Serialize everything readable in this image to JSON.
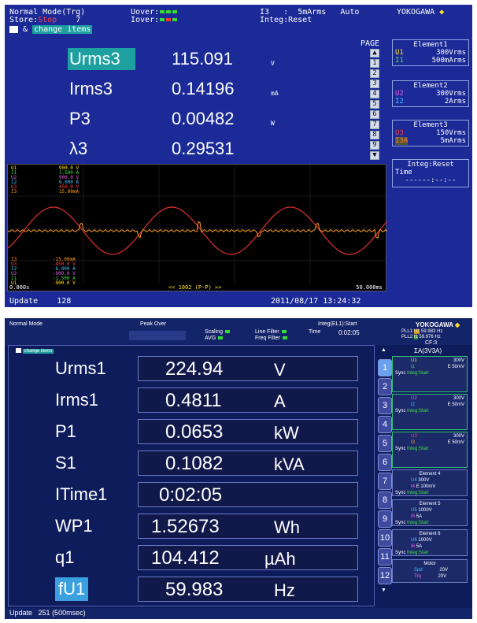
{
  "top": {
    "mode": "Normal Mode(Trg)",
    "store_label": "Store:",
    "store_value": "Stop",
    "store_count": "7",
    "uover": "Uover:",
    "iover": "Iover:",
    "range_ch": "I3",
    "range_sep": ":",
    "range_val": "5mArms",
    "range_auto": "Auto",
    "integ": "Integ:Reset",
    "brand": "YOKOGAWA",
    "change_items": "change items",
    "page_label": "PAGE",
    "pages": [
      "1",
      "2",
      "3",
      "4",
      "5",
      "6",
      "7",
      "8",
      "9"
    ],
    "rows": [
      {
        "label": "Urms3",
        "value": "115.091",
        "unit": "V"
      },
      {
        "label": "Irms3",
        "value": "0.14196",
        "unit": "mA"
      },
      {
        "label": "P3",
        "value": "0.00482",
        "unit": "W"
      },
      {
        "label": "λ3",
        "value": "0.29531",
        "unit": ""
      }
    ],
    "elements": [
      {
        "title": "Element1",
        "l1a": "U1",
        "l1b": "300Vrms",
        "l2a": "I1",
        "l2b": "500mArms"
      },
      {
        "title": "Element2",
        "l1a": "U2",
        "l1b": "300Vrms",
        "l2a": "I2",
        "l2b": "2Arms"
      },
      {
        "title": "Element3",
        "l1a": "U3",
        "l1b": "150Vrms",
        "l2a": "I3A",
        "l2b": "5mArms"
      }
    ],
    "integ_box": {
      "title": "Integ:Reset",
      "time_label": "Time",
      "time_value": "------:--:--"
    },
    "scope": {
      "upper": [
        [
          "U1",
          "900.0 V"
        ],
        [
          "I1",
          "1.500 A"
        ],
        [
          "U2",
          "900.0 V"
        ],
        [
          "I2",
          "6.000 A"
        ],
        [
          "U3",
          "450.0 V"
        ],
        [
          "I3",
          "15.00mA"
        ]
      ],
      "lower": [
        [
          "I3",
          "-15.00mA"
        ],
        [
          "U3",
          "-450.0 V"
        ],
        [
          "I2",
          "-6.000 A"
        ],
        [
          "U2",
          "-900.0 V"
        ],
        [
          "I1",
          "-1.500 A"
        ],
        [
          "U1",
          "-900.0 V"
        ]
      ],
      "t_start": "0.000s",
      "t_end": "50.000ms",
      "center": "<< 1002 (P-P) >>"
    },
    "update_label": "Update",
    "update_value": "128",
    "datetime": "2011/08/17 13:24:32"
  },
  "bottom": {
    "mode": "Normal Mode",
    "peak": "Peak Over",
    "scaling": "Scaling",
    "avg": "AVG",
    "line_filter": "Line Filter",
    "freq_filter": "Freq Filter",
    "integ": "Integ(EL1):Start",
    "time": "Time",
    "time_value": "0:02:05",
    "brand": "YOKOGAWA",
    "pll1": "PLL1:",
    "pll1_ch": "U1",
    "pll1_val": "59.983 Hz",
    "pll2": "PLL2:",
    "pll2_ch": "I1",
    "pll2_val": "59.976 Hz",
    "cf": "CF:3",
    "sigma": "ΣA(3V3A)",
    "change_items": "change items",
    "rows": [
      {
        "label": "Urms1",
        "value": "224.94",
        "unit": "V"
      },
      {
        "label": "Irms1",
        "value": "0.4811",
        "unit": "A"
      },
      {
        "label": "P1",
        "value": "0.0653",
        "unit": "kW"
      },
      {
        "label": "S1",
        "value": "0.1082",
        "unit": "kVA"
      },
      {
        "label": "ITime1",
        "value": "0:02:05",
        "unit": ""
      },
      {
        "label": "WP1",
        "value": "1.52673",
        "unit": "Wh"
      },
      {
        "label": "q1",
        "value": "104.412",
        "unit": "µAh"
      },
      {
        "label": "fU1",
        "value": "59.983",
        "unit": "Hz"
      }
    ],
    "tabs": [
      "1",
      "2",
      "3",
      "4",
      "5",
      "6",
      "7",
      "8",
      "9",
      "10",
      "11",
      "12"
    ],
    "elements": [
      {
        "u": "U1",
        "urange": "300V",
        "i": "I1",
        "irange": "E 50mV",
        "sync": "Sync",
        "integ": "Integ:Start"
      },
      {
        "u": "U2",
        "urange": "300V",
        "i": "I2",
        "irange": "E 50mV",
        "sync": "Sync",
        "integ": "Integ:Start"
      },
      {
        "u": "U3",
        "urange": "300V",
        "i": "I3",
        "irange": "E 50mV",
        "sync": "Sync",
        "integ": "Integ:Start"
      }
    ],
    "elements_small": [
      {
        "title": "Element 4",
        "u": "U4",
        "urange": "300V",
        "i": "I4",
        "irange": "E 100mV",
        "sync": "Sync",
        "integ": "Integ:Start"
      },
      {
        "title": "Element 5",
        "u": "U5",
        "urange": "1000V",
        "i": "I5",
        "irange": "5A",
        "sync": "Sync",
        "integ": "Integ:Start"
      },
      {
        "title": "Element 6",
        "u": "U6",
        "urange": "1000V",
        "i": "I6",
        "irange": "5A",
        "sync": "Sync",
        "integ": "Integ:Start"
      }
    ],
    "motor": {
      "title": "Motor",
      "spd": "Spd",
      "spd_val": "20V",
      "trq": "Trq",
      "trq_val": "20V"
    },
    "update_label": "Update",
    "update_value": "251 (500msec)"
  },
  "colors": {
    "waveU": "#e03030",
    "waveI": "#ffa020",
    "accent": "#1ea0a0",
    "highlight": "#3aa0e0"
  }
}
